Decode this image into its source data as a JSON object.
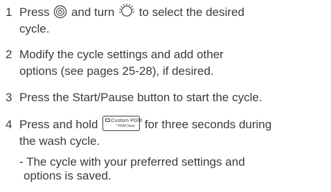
{
  "steps": [
    {
      "number": "1",
      "text_a": "Press",
      "icon_1": "power-button-icon",
      "text_b": "and turn",
      "icon_2": "cycle-dial-icon",
      "text_c": "to select the desired",
      "line2": "cycle."
    },
    {
      "number": "2",
      "line1": "Modify the cycle settings and add other",
      "line2": "options (see pages 25-28), if desired."
    },
    {
      "number": "3",
      "line1": "Press the Start/Pause button to start the cycle."
    },
    {
      "number": "4",
      "text_a": "Press and hold",
      "button_label": "Custom PGM",
      "button_sublabel": "* PGM Save",
      "text_b": "for three seconds during",
      "line2": "the wash cycle.",
      "note_line1": "- The cycle with your preferred settings and",
      "note_line2": "options is saved."
    }
  ]
}
